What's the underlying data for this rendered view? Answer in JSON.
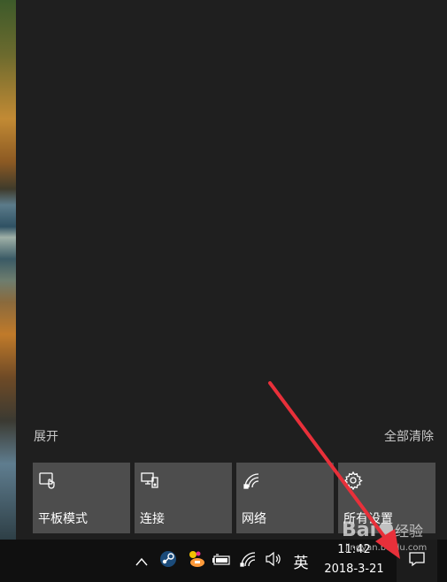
{
  "action_center": {
    "expand_label": "展开",
    "clear_all_label": "全部清除",
    "quick_actions": [
      {
        "label": "平板模式",
        "icon": "tablet-mode-icon"
      },
      {
        "label": "连接",
        "icon": "connect-icon"
      },
      {
        "label": "网络",
        "icon": "network-icon"
      },
      {
        "label": "所有设置",
        "icon": "gear-icon"
      }
    ]
  },
  "taskbar": {
    "ime_label": "英",
    "clock_time": "11:42",
    "clock_date": "2018-3-21"
  },
  "watermark": {
    "text": "jingyan.baidu.com"
  },
  "colors": {
    "panel_bg": "#1f1f1f",
    "tile_bg": "#4d4d4d",
    "taskbar_bg": "#101010",
    "annotation_red": "#e8303a"
  }
}
